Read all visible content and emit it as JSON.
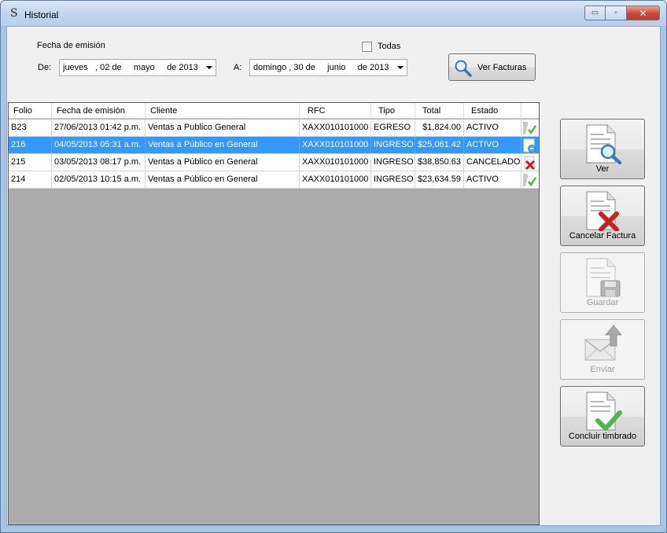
{
  "window": {
    "title": "Historial",
    "controls": {
      "minimize": "▭",
      "maximize": "▫",
      "close": "✕"
    }
  },
  "filters": {
    "fecha_label": "Fecha de emisión",
    "todas_label": "Todas",
    "todas_checked": false,
    "de_label": "De:",
    "de_value": "jueves   , 02 de     mayo     de 2013",
    "a_label": "A:",
    "a_value": "domingo , 30 de     junio     de 2013",
    "ver_facturas_label": "Ver Facturas"
  },
  "grid": {
    "columns": [
      "Folio",
      "Fecha de emisión",
      "Cliente",
      "RFC",
      "Tipo",
      "Total",
      "Estado"
    ],
    "rows": [
      {
        "folio": "B23",
        "fecha": "27/06/2013 01:42 p.m.",
        "cliente": "Ventas a Publico General",
        "rfc": "XAXX010101000",
        "tipo": "EGRESO",
        "total": "$1,824.00",
        "estado": "ACTIVO",
        "icon": "check-icon",
        "selected": false
      },
      {
        "folio": "216",
        "fecha": "04/05/2013 05:31 a.m.",
        "cliente": "Ventas a Público en General",
        "rfc": "XAXX010101000",
        "tipo": "INGRESO",
        "total": "$25,061.42",
        "estado": "ACTIVO",
        "icon": "pending-icon",
        "selected": true
      },
      {
        "folio": "215",
        "fecha": "03/05/2013 08:17 p.m.",
        "cliente": "Ventas a Público en General",
        "rfc": "XAXX010101000",
        "tipo": "INGRESO",
        "total": "$38,850.63",
        "estado": "CANCELADO",
        "icon": "cancel-icon",
        "selected": false
      },
      {
        "folio": "214",
        "fecha": "02/05/2013 10:15 a.m.",
        "cliente": "Ventas a Público en General",
        "rfc": "XAXX010101000",
        "tipo": "INGRESO",
        "total": "$23,634.59",
        "estado": "ACTIVO",
        "icon": "check-icon",
        "selected": false
      }
    ]
  },
  "actions": {
    "ver": {
      "label": "Ver",
      "enabled": true,
      "icon": "document-search-icon"
    },
    "cancelar": {
      "label": "Cancelar Factura",
      "enabled": true,
      "icon": "document-cancel-icon"
    },
    "guardar": {
      "label": "Guardar",
      "enabled": false,
      "icon": "document-save-icon"
    },
    "enviar": {
      "label": "Enviar",
      "enabled": false,
      "icon": "envelope-send-icon"
    },
    "concluir": {
      "label": "Concluir timbrado",
      "enabled": true,
      "icon": "document-check-icon"
    }
  },
  "colors": {
    "selection": "#3399ff",
    "grid_background": "#ababab",
    "cancel_red": "#cc1f1f",
    "check_green": "#4cb648"
  }
}
